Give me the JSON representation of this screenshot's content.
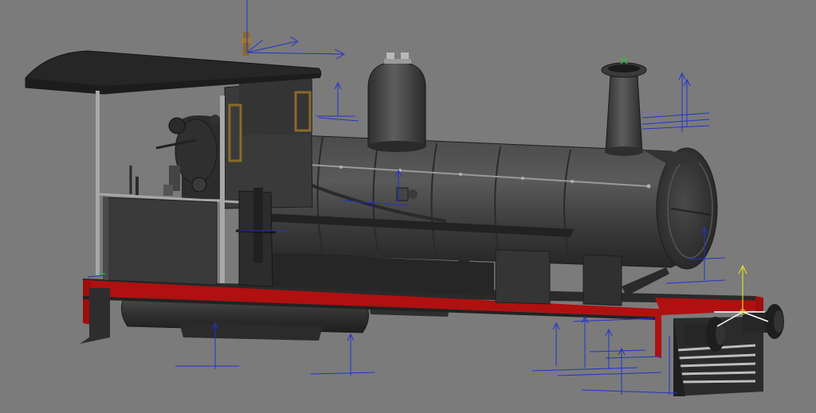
{
  "viewport": {
    "background": "#7b7b7b",
    "model": "steam-locomotive",
    "colors": {
      "body": "#3d3d3d",
      "body_dark": "#232323",
      "body_light": "#5a5a5a",
      "frame_red": "#b01010",
      "cab_window": "#8a6a2a",
      "gizmo_blue": "#2233cc",
      "gizmo_green": "#22cc22",
      "gizmo_yellow": "#dddd22",
      "gizmo_white": "#ffffff"
    }
  }
}
